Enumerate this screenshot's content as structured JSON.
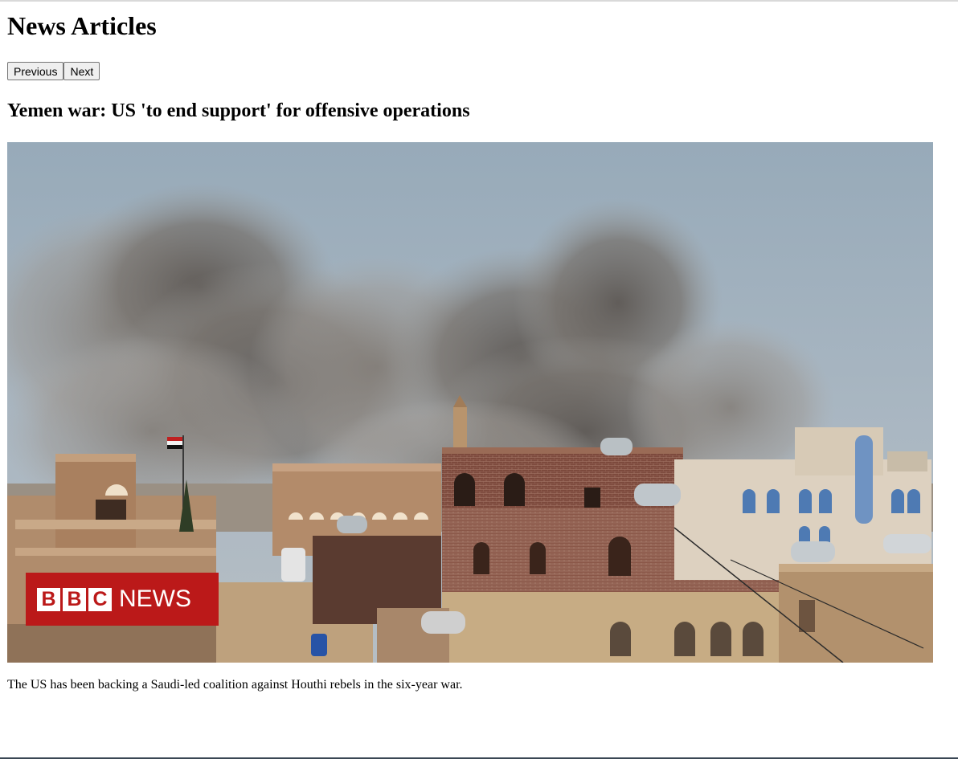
{
  "page": {
    "title": "News Articles"
  },
  "nav": {
    "previous_label": "Previous",
    "next_label": "Next"
  },
  "article": {
    "headline": "Yemen war: US 'to end support' for offensive operations",
    "image_alt": "Smoke rising over buildings",
    "logo": {
      "letters": [
        "B",
        "B",
        "C"
      ],
      "word": "NEWS",
      "color": "#bb1919"
    },
    "caption": "The US has been backing a Saudi-led coalition against Houthi rebels in the six-year war."
  }
}
